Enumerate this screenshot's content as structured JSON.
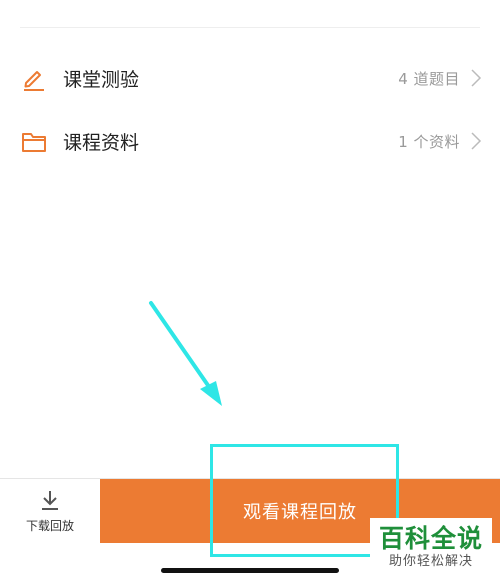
{
  "list": {
    "items": [
      {
        "label": "课堂测验",
        "meta": "4 道题目",
        "icon": "pencil-icon"
      },
      {
        "label": "课程资料",
        "meta": "1 个资料",
        "icon": "folder-icon"
      }
    ]
  },
  "bottom_bar": {
    "download_label": "下载回放",
    "watch_label": "观看课程回放"
  },
  "watermark": {
    "title": "百科全说",
    "subtitle": "助你轻松解决"
  },
  "colors": {
    "accent": "#ec7b33",
    "annotation": "#2ee6e6",
    "watermark_green": "#1f8f3a"
  }
}
